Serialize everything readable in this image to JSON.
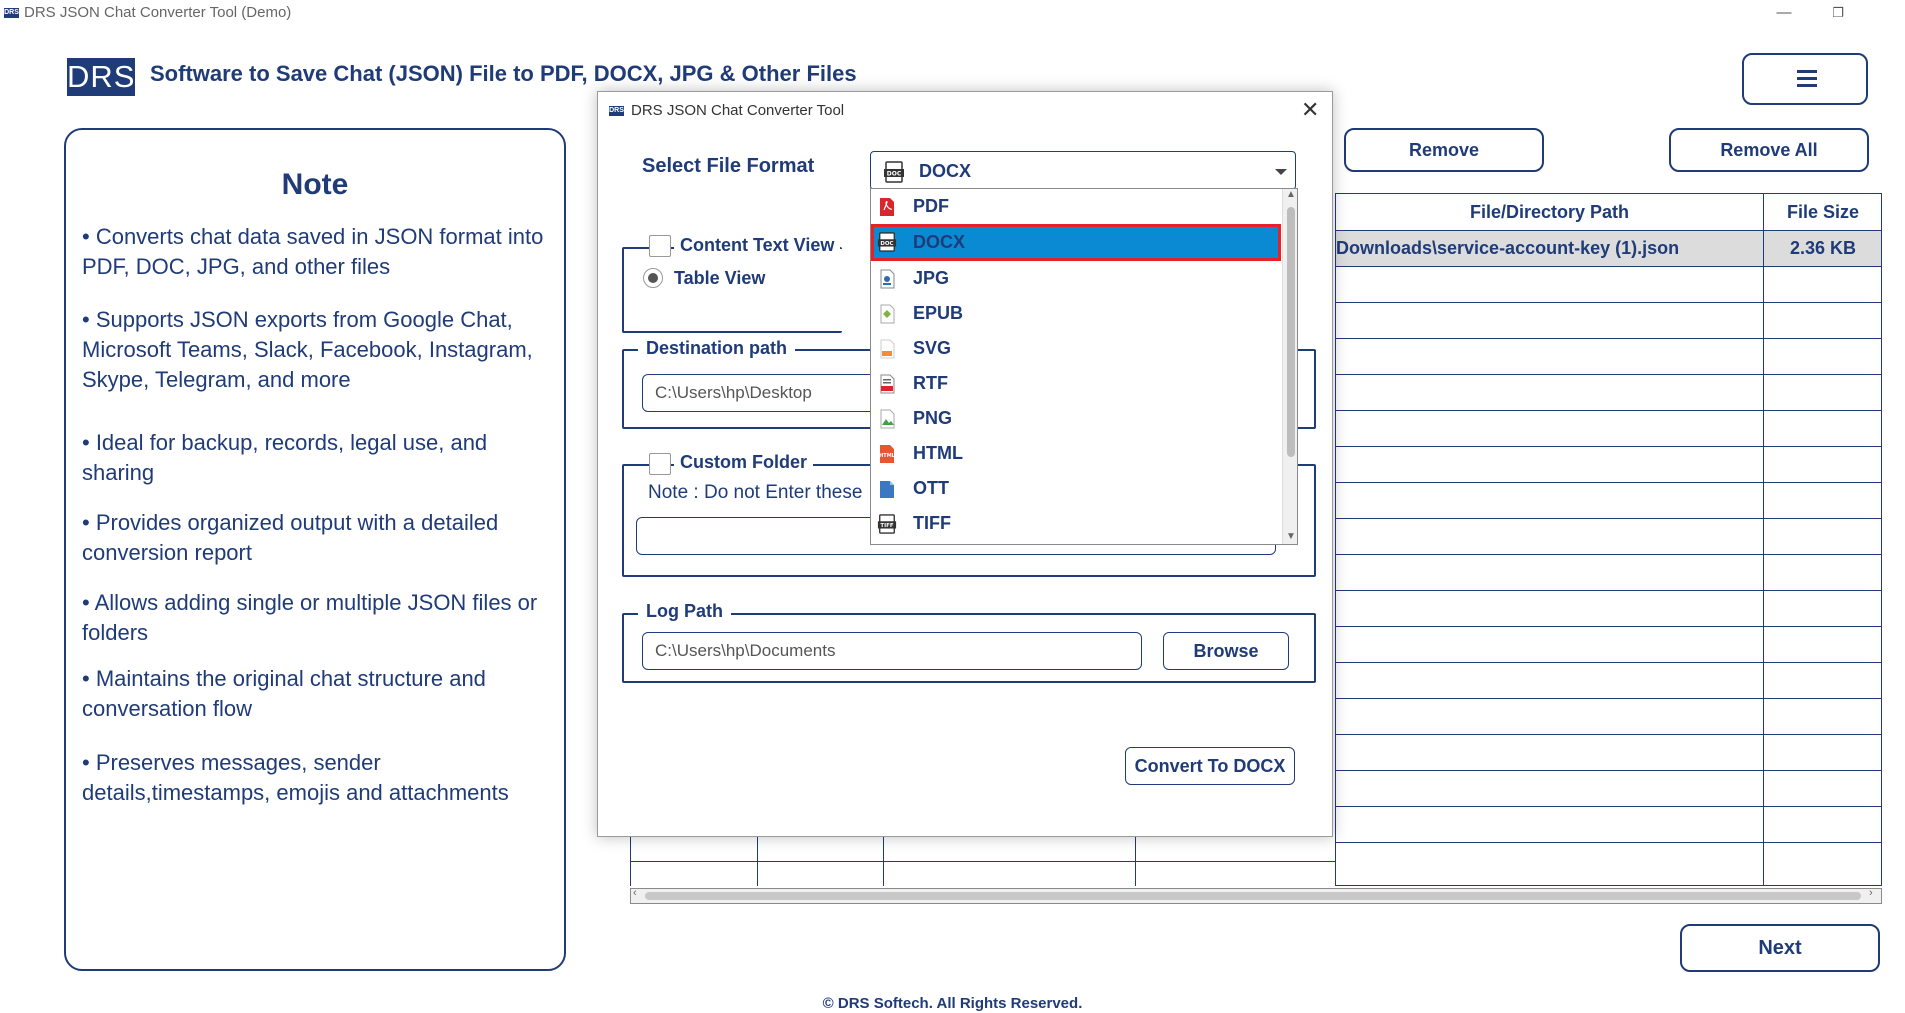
{
  "window": {
    "title": "DRS JSON Chat Converter Tool (Demo)",
    "logo_text": "DRS"
  },
  "header": {
    "logo_text": "DRS",
    "title": "Software to Save Chat (JSON) File to PDF, DOCX, JPG & Other Files"
  },
  "note": {
    "title": "Note",
    "items": [
      " • Converts chat data saved in JSON format into  PDF, DOC, JPG, and other files",
      "• Supports JSON exports from Google Chat, Microsoft Teams, Slack, Facebook, Instagram, Skype, Telegram, and more",
      "• Ideal for backup, records, legal use, and sharing",
      "• Provides organized output with a detailed conversion report",
      "• Allows adding single or multiple JSON files or folders",
      "• Maintains the original chat structure and conversation flow",
      "• Preserves messages, sender details,timestamps, emojis and attachments"
    ]
  },
  "main": {
    "remove_label": "Remove",
    "remove_all_label": "Remove All",
    "table": {
      "columns": [
        "File/Directory Path",
        "File Size"
      ],
      "rows": [
        {
          "path": "Downloads\\service-account-key (1).json",
          "size": "2.36 KB"
        }
      ]
    },
    "next_label": "Next"
  },
  "footer": {
    "text": "© DRS Softech. All Rights Reserved."
  },
  "dialog": {
    "title": "DRS JSON Chat Converter Tool",
    "logo_text": "DRS",
    "select_format_label": "Select File Format",
    "selected_format": "DOCX",
    "view_options": {
      "content_text_view": "Content Text View",
      "table_view": "Table View",
      "table_view_selected": true,
      "content_text_view_checked": false
    },
    "destination": {
      "legend": "Destination path",
      "value": "C:\\Users\\hp\\Desktop"
    },
    "custom_folder": {
      "legend": "Custom Folder",
      "checked": false,
      "note": "Note : Do not Enter these",
      "value": ""
    },
    "log_path": {
      "legend": "Log Path",
      "value": "C:\\Users\\hp\\Documents",
      "browse_label": "Browse"
    },
    "convert_label": "Convert To DOCX"
  },
  "dropdown": {
    "options": [
      {
        "label": "PDF",
        "icon": "pdf-file-icon",
        "color": "#d9262c"
      },
      {
        "label": "DOCX",
        "icon": "docx-file-icon",
        "color": "#333333"
      },
      {
        "label": "JPG",
        "icon": "jpg-file-icon",
        "color": "#2b6cb0"
      },
      {
        "label": "EPUB",
        "icon": "epub-file-icon",
        "color": "#7cb342"
      },
      {
        "label": "SVG",
        "icon": "svg-file-icon",
        "color": "#f08c3c"
      },
      {
        "label": "RTF",
        "icon": "rtf-file-icon",
        "color": "#d9262c"
      },
      {
        "label": "PNG",
        "icon": "png-file-icon",
        "color": "#43a047"
      },
      {
        "label": "HTML",
        "icon": "html-file-icon",
        "color": "#e8552e"
      },
      {
        "label": "OTT",
        "icon": "ott-file-icon",
        "color": "#3a78c2"
      },
      {
        "label": "TIFF",
        "icon": "tiff-file-icon",
        "color": "#333333"
      }
    ],
    "selected": "DOCX"
  },
  "colors": {
    "brand": "#1f3b78",
    "selection": "#0a8ad3",
    "highlight_border": "#e8202a"
  }
}
